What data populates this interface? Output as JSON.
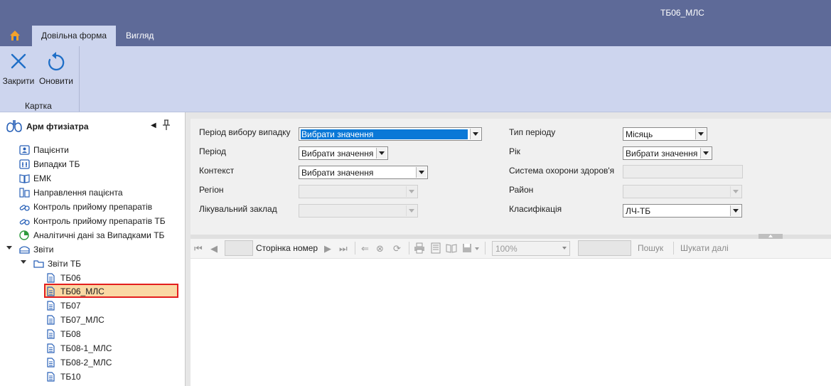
{
  "window": {
    "title": "ТБ06_МЛС"
  },
  "tabs": [
    {
      "label": "",
      "icon": "home-icon"
    },
    {
      "label": "Довільна форма"
    },
    {
      "label": "Вигляд"
    }
  ],
  "ribbon": {
    "buttons": [
      {
        "label": "Закрити",
        "icon": "close-x-icon"
      },
      {
        "label": "Оновити",
        "icon": "refresh-icon"
      }
    ],
    "group_label": "Картка"
  },
  "sidebar": {
    "title": "Арм фтизіатра",
    "items": [
      {
        "label": "Пацієнти",
        "icon": "patient-card-icon"
      },
      {
        "label": "Випадки ТБ",
        "icon": "lungs-icon"
      },
      {
        "label": "ЕМК",
        "icon": "book-icon"
      },
      {
        "label": "Направлення пацієнта",
        "icon": "referral-icon"
      },
      {
        "label": "Контроль прийому препаратів",
        "icon": "pills-icon"
      },
      {
        "label": "Контроль прийому препаратів ТБ",
        "icon": "pills-icon"
      },
      {
        "label": "Аналітичні дані за Випадками ТБ",
        "icon": "analytics-icon"
      },
      {
        "label": "Звіти",
        "icon": "reports-icon"
      },
      {
        "label": "Звіти ТБ",
        "icon": "folder-icon"
      },
      {
        "label": "ТБ06",
        "icon": "document-icon"
      },
      {
        "label": "ТБ06_МЛС",
        "icon": "document-icon"
      },
      {
        "label": "ТБ07",
        "icon": "document-icon"
      },
      {
        "label": "ТБ07_МЛС",
        "icon": "document-icon"
      },
      {
        "label": "ТБ08",
        "icon": "document-icon"
      },
      {
        "label": "ТБ08-1_МЛС",
        "icon": "document-icon"
      },
      {
        "label": "ТБ08-2_МЛС",
        "icon": "document-icon"
      },
      {
        "label": "ТБ10",
        "icon": "document-icon"
      }
    ]
  },
  "form": {
    "left_labels": [
      "Період вибору випадку",
      "Період",
      "Контекст",
      "Регіон",
      "Лікувальний заклад"
    ],
    "left_values": [
      "Вибрати значення",
      "Вибрати значення",
      "Вибрати значення",
      "",
      ""
    ],
    "right_labels": [
      "Тип періоду",
      "Рік",
      "Система охорони здоров'я",
      "Район",
      "Класифікація"
    ],
    "right_values": [
      "Місяць",
      "Вибрати значення",
      "",
      "",
      "ЛЧ-ТБ"
    ]
  },
  "viewer": {
    "page_label": "Сторінка номер",
    "zoom": "100%",
    "search_label": "Пошук",
    "find_next_label": "Шукати далі"
  },
  "colors": {
    "titlebar": "#5e6a98",
    "ribbon": "#cdd5ee",
    "selection_fill": "#fad8a4",
    "selection_border": "#e31e1e",
    "combo_highlight": "#0a78d7",
    "icon_blue": "#1f6fc7"
  }
}
